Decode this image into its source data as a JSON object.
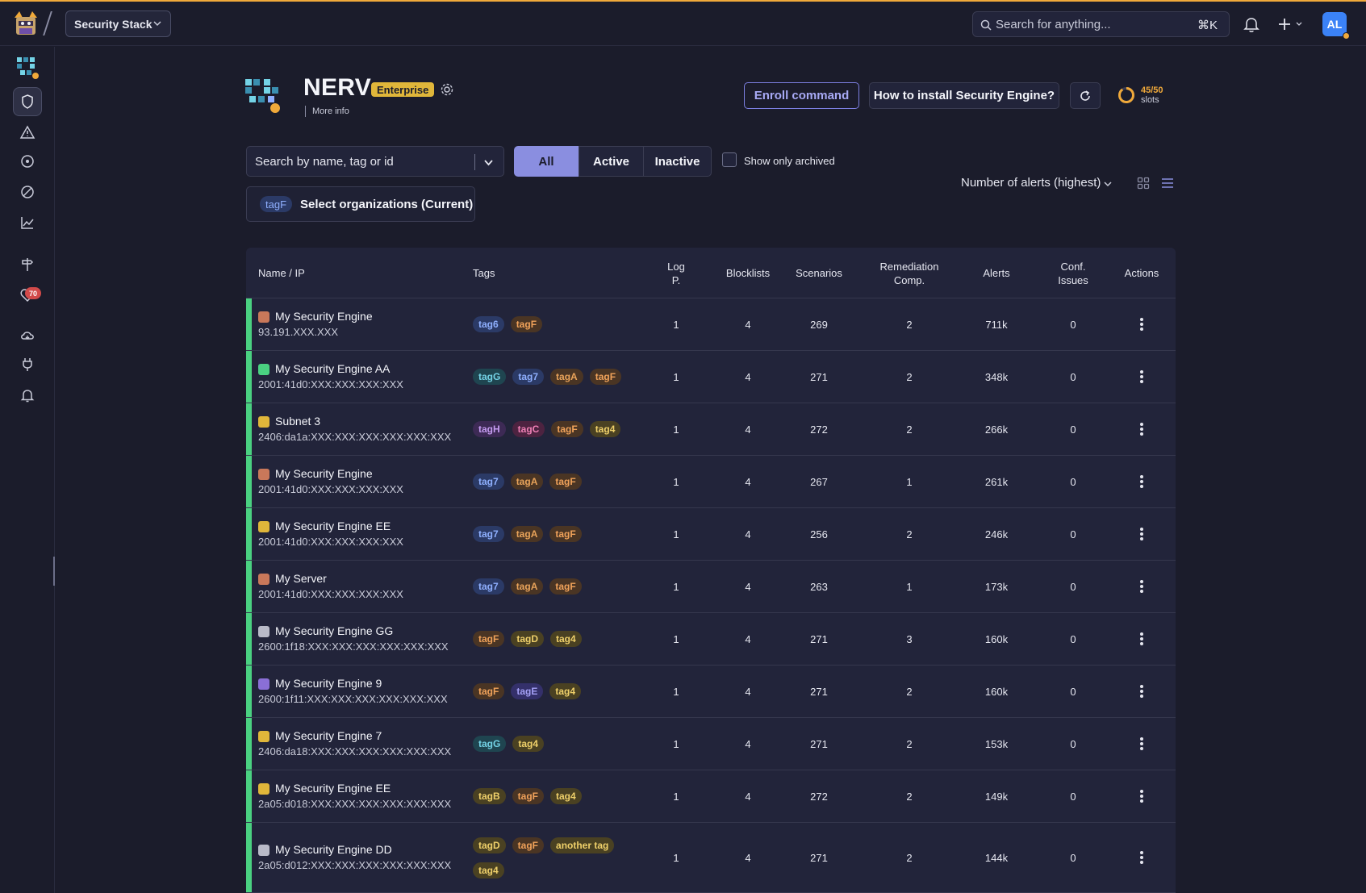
{
  "topbar": {
    "stack_label": "Security Stack",
    "search_placeholder": "Search for anything...",
    "search_shortcut": "⌘K",
    "avatar_initials": "AL"
  },
  "sidebar": {
    "items": [
      "home-logo",
      "shield-icon",
      "alert-triangle-icon",
      "crosshair-icon",
      "ban-icon",
      "chart-line-icon",
      "signpost-icon",
      "heart-pulse-icon",
      "cloud-download-icon",
      "plug-icon",
      "bell-icon"
    ],
    "health_badge": "70"
  },
  "org": {
    "name": "NERV",
    "plan": "Enterprise",
    "more_info": "More info"
  },
  "actions": {
    "enroll": "Enroll command",
    "install": "How to install Security Engine?",
    "slots_value": "45/50",
    "slots_label": "slots",
    "slots_used": 45,
    "slots_total": 50
  },
  "filters": {
    "search_placeholder": "Search by name, tag or id",
    "seg_all": "All",
    "seg_active": "Active",
    "seg_inactive": "Inactive",
    "show_archived": "Show only archived",
    "org_tag": "tagF",
    "org_select": "Select organizations (Current)",
    "sort": "Number of alerts (highest)"
  },
  "colors": {
    "accent": "#8a8ee0",
    "status_active": "#4ad181",
    "brand_orange": "#f0a93a"
  },
  "table": {
    "headers": {
      "name": "Name / IP",
      "tags": "Tags",
      "logp": "Log P.",
      "blocklists": "Blocklists",
      "scenarios": "Scenarios",
      "remediation": "Remediation Comp.",
      "alerts": "Alerts",
      "conf": "Conf. Issues",
      "actions": "Actions"
    },
    "rows": [
      {
        "name": "My Security Engine",
        "ip": "93.191.XXX.XXX",
        "tags": [
          "tag6",
          "tagF"
        ],
        "logp": "1",
        "blocklists": "4",
        "scenarios": "269",
        "remediation": "2",
        "alerts": "711k",
        "conf": "0"
      },
      {
        "name": "My Security Engine AA",
        "ip": "2001:41d0:XXX:XXX:XXX:XXX",
        "tags": [
          "tagG",
          "tag7",
          "tagA",
          "tagF"
        ],
        "logp": "1",
        "blocklists": "4",
        "scenarios": "271",
        "remediation": "2",
        "alerts": "348k",
        "conf": "0"
      },
      {
        "name": "Subnet 3",
        "ip": "2406:da1a:XXX:XXX:XXX:XXX:XXX:XXX",
        "tags": [
          "tagH",
          "tagC",
          "tagF",
          "tag4"
        ],
        "logp": "1",
        "blocklists": "4",
        "scenarios": "272",
        "remediation": "2",
        "alerts": "266k",
        "conf": "0"
      },
      {
        "name": "My Security Engine",
        "ip": "2001:41d0:XXX:XXX:XXX:XXX",
        "tags": [
          "tag7",
          "tagA",
          "tagF"
        ],
        "logp": "1",
        "blocklists": "4",
        "scenarios": "267",
        "remediation": "1",
        "alerts": "261k",
        "conf": "0"
      },
      {
        "name": "My Security Engine EE",
        "ip": "2001:41d0:XXX:XXX:XXX:XXX",
        "tags": [
          "tag7",
          "tagA",
          "tagF"
        ],
        "logp": "1",
        "blocklists": "4",
        "scenarios": "256",
        "remediation": "2",
        "alerts": "246k",
        "conf": "0"
      },
      {
        "name": "My Server",
        "ip": "2001:41d0:XXX:XXX:XXX:XXX",
        "tags": [
          "tag7",
          "tagA",
          "tagF"
        ],
        "logp": "1",
        "blocklists": "4",
        "scenarios": "263",
        "remediation": "1",
        "alerts": "173k",
        "conf": "0"
      },
      {
        "name": "My Security Engine GG",
        "ip": "2600:1f18:XXX:XXX:XXX:XXX:XXX:XXX",
        "tags": [
          "tagF",
          "tagD",
          "tag4"
        ],
        "logp": "1",
        "blocklists": "4",
        "scenarios": "271",
        "remediation": "3",
        "alerts": "160k",
        "conf": "0"
      },
      {
        "name": "My Security Engine 9",
        "ip": "2600:1f11:XXX:XXX:XXX:XXX:XXX:XXX",
        "tags": [
          "tagF",
          "tagE",
          "tag4"
        ],
        "logp": "1",
        "blocklists": "4",
        "scenarios": "271",
        "remediation": "2",
        "alerts": "160k",
        "conf": "0"
      },
      {
        "name": "My Security Engine 7",
        "ip": "2406:da18:XXX:XXX:XXX:XXX:XXX:XXX",
        "tags": [
          "tagG",
          "tag4"
        ],
        "logp": "1",
        "blocklists": "4",
        "scenarios": "271",
        "remediation": "2",
        "alerts": "153k",
        "conf": "0"
      },
      {
        "name": "My Security Engine EE",
        "ip": "2a05:d018:XXX:XXX:XXX:XXX:XXX:XXX",
        "tags": [
          "tagB",
          "tagF",
          "tag4"
        ],
        "logp": "1",
        "blocklists": "4",
        "scenarios": "272",
        "remediation": "2",
        "alerts": "149k",
        "conf": "0"
      },
      {
        "name": "My Security Engine DD",
        "ip": "2a05:d012:XXX:XXX:XXX:XXX:XXX:XXX",
        "tags": [
          "tagD",
          "tagF",
          "another tag",
          "tag4"
        ],
        "logp": "1",
        "blocklists": "4",
        "scenarios": "271",
        "remediation": "2",
        "alerts": "144k",
        "conf": "0"
      }
    ]
  },
  "tag_colors": {
    "tag6": {
      "bg": "#2b3a66",
      "fg": "#8fb0ff"
    },
    "tag7": {
      "bg": "#2b3a66",
      "fg": "#8fb0ff"
    },
    "tagF": {
      "bg": "#4a3524",
      "fg": "#f0a25a"
    },
    "tagG": {
      "bg": "#1f4550",
      "fg": "#74d3e6"
    },
    "tagA": {
      "bg": "#4a3524",
      "fg": "#e8a35a"
    },
    "tagH": {
      "bg": "#3d2a55",
      "fg": "#c69cf2"
    },
    "tagC": {
      "bg": "#4d2340",
      "fg": "#ef7fb5"
    },
    "tag4": {
      "bg": "#4a4122",
      "fg": "#efd06a"
    },
    "tagD": {
      "bg": "#4a4122",
      "fg": "#efd06a"
    },
    "tagE": {
      "bg": "#34306a",
      "fg": "#a4a0f5"
    },
    "tagB": {
      "bg": "#4a4122",
      "fg": "#efd06a"
    },
    "another tag": {
      "bg": "#4a4122",
      "fg": "#efd06a"
    }
  },
  "engine_icon_colors": [
    "#c9785a",
    "#4ad181",
    "#e0b63a",
    "#c9785a",
    "#e0b63a",
    "#c9785a",
    "#b9bac8",
    "#8a6fd6",
    "#e0b63a",
    "#e0b63a",
    "#b9bac8"
  ]
}
